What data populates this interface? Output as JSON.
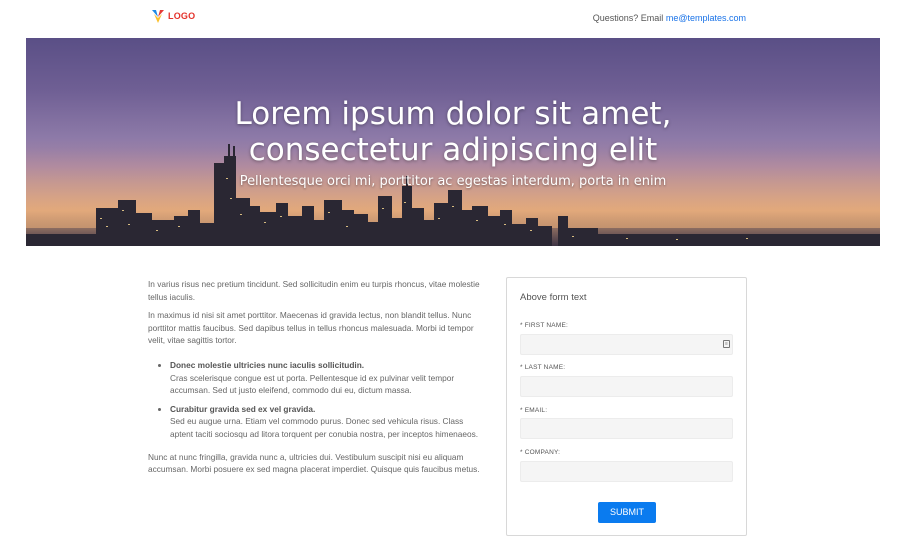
{
  "header": {
    "logo_text": "LOGO",
    "contact_prefix": "Questions? Email",
    "contact_email": "me@templates.com"
  },
  "hero": {
    "title": "Lorem ipsum dolor sit amet, consectetur adipiscing elit",
    "subtitle": "Pellentesque orci mi, porttitor ac egestas interdum, porta in enim"
  },
  "content": {
    "para1": "In varius risus nec pretium tincidunt. Sed sollicitudin enim eu turpis rhoncus, vitae molestie tellus iaculis.",
    "para2": "In maximus id nisi sit amet porttitor. Maecenas id gravida lectus, non blandit tellus. Nunc porttitor mattis faucibus. Sed dapibus tellus in tellus rhoncus malesuada. Morbi id tempor velit, vitae sagittis tortor.",
    "bullets": [
      {
        "title": "Donec molestie ultricies nunc iaculis sollicitudin.",
        "text": "Cras scelerisque congue est ut porta. Pellentesque id ex pulvinar velit tempor accumsan. Sed ut justo eleifend, commodo dui eu, dictum massa."
      },
      {
        "title": "Curabitur gravida sed ex vel gravida.",
        "text": "Sed eu augue urna. Etiam vel commodo purus. Donec sed vehicula risus. Class aptent taciti sociosqu ad litora torquent per conubia nostra, per inceptos himenaeos."
      }
    ],
    "para3": "Nunc at nunc fringilla, gravida nunc a, ultricies dui. Vestibulum suscipit nisi eu aliquam accumsan. Morbi posuere ex sed magna placerat imperdiet. Quisque quis faucibus metus."
  },
  "form": {
    "title": "Above form text",
    "fields": [
      {
        "label": "* FIRST NAME:",
        "value": ""
      },
      {
        "label": "* LAST NAME:",
        "value": ""
      },
      {
        "label": "* EMAIL:",
        "value": ""
      },
      {
        "label": "* COMPANY:",
        "value": ""
      }
    ],
    "submit_label": "SUBMIT"
  },
  "colors": {
    "accent": "#0a7bef",
    "link": "#1a73e8",
    "logo_red": "#e4322b"
  }
}
